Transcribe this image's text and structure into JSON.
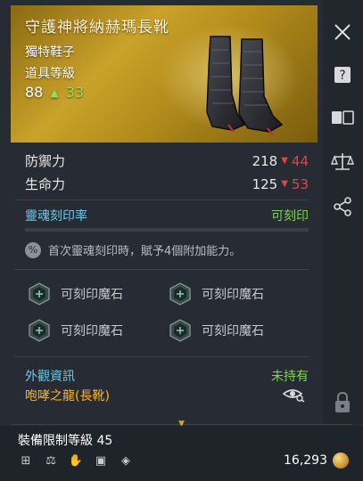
{
  "item": {
    "title": "守護神將納赫瑪長靴",
    "rarity": "獨特鞋子",
    "level_label": "道具等級",
    "level_base": "88",
    "level_bonus": "33"
  },
  "stats": [
    {
      "label": "防禦力",
      "value": "218",
      "delta": "44"
    },
    {
      "label": "生命力",
      "value": "125",
      "delta": "53"
    }
  ],
  "soul": {
    "label": "靈魂刻印率",
    "status": "可刻印",
    "note": "首次靈魂刻印時，賦予4個附加能力。"
  },
  "slots": [
    {
      "label": "可刻印魔石"
    },
    {
      "label": "可刻印魔石"
    },
    {
      "label": "可刻印魔石"
    },
    {
      "label": "可刻印魔石"
    }
  ],
  "appearance": {
    "label": "外觀資訊",
    "status": "未持有",
    "name": "咆哮之龍(長靴)"
  },
  "footer": {
    "requirement": "裝備限制等級 45",
    "price": "16,293"
  },
  "colors": {
    "accent_gold": "#c9a22a",
    "positive": "#7fd64a",
    "negative": "#e24545",
    "info": "#6cc8e8",
    "appearance_name": "#f0b53a"
  },
  "icons": {
    "rail": [
      "close-icon",
      "help-icon",
      "compare-icon",
      "scale-icon",
      "share-icon",
      "lock-icon"
    ],
    "footer": [
      "storage-icon",
      "trade-icon",
      "hand-icon",
      "card-icon",
      "diamond-icon"
    ]
  }
}
